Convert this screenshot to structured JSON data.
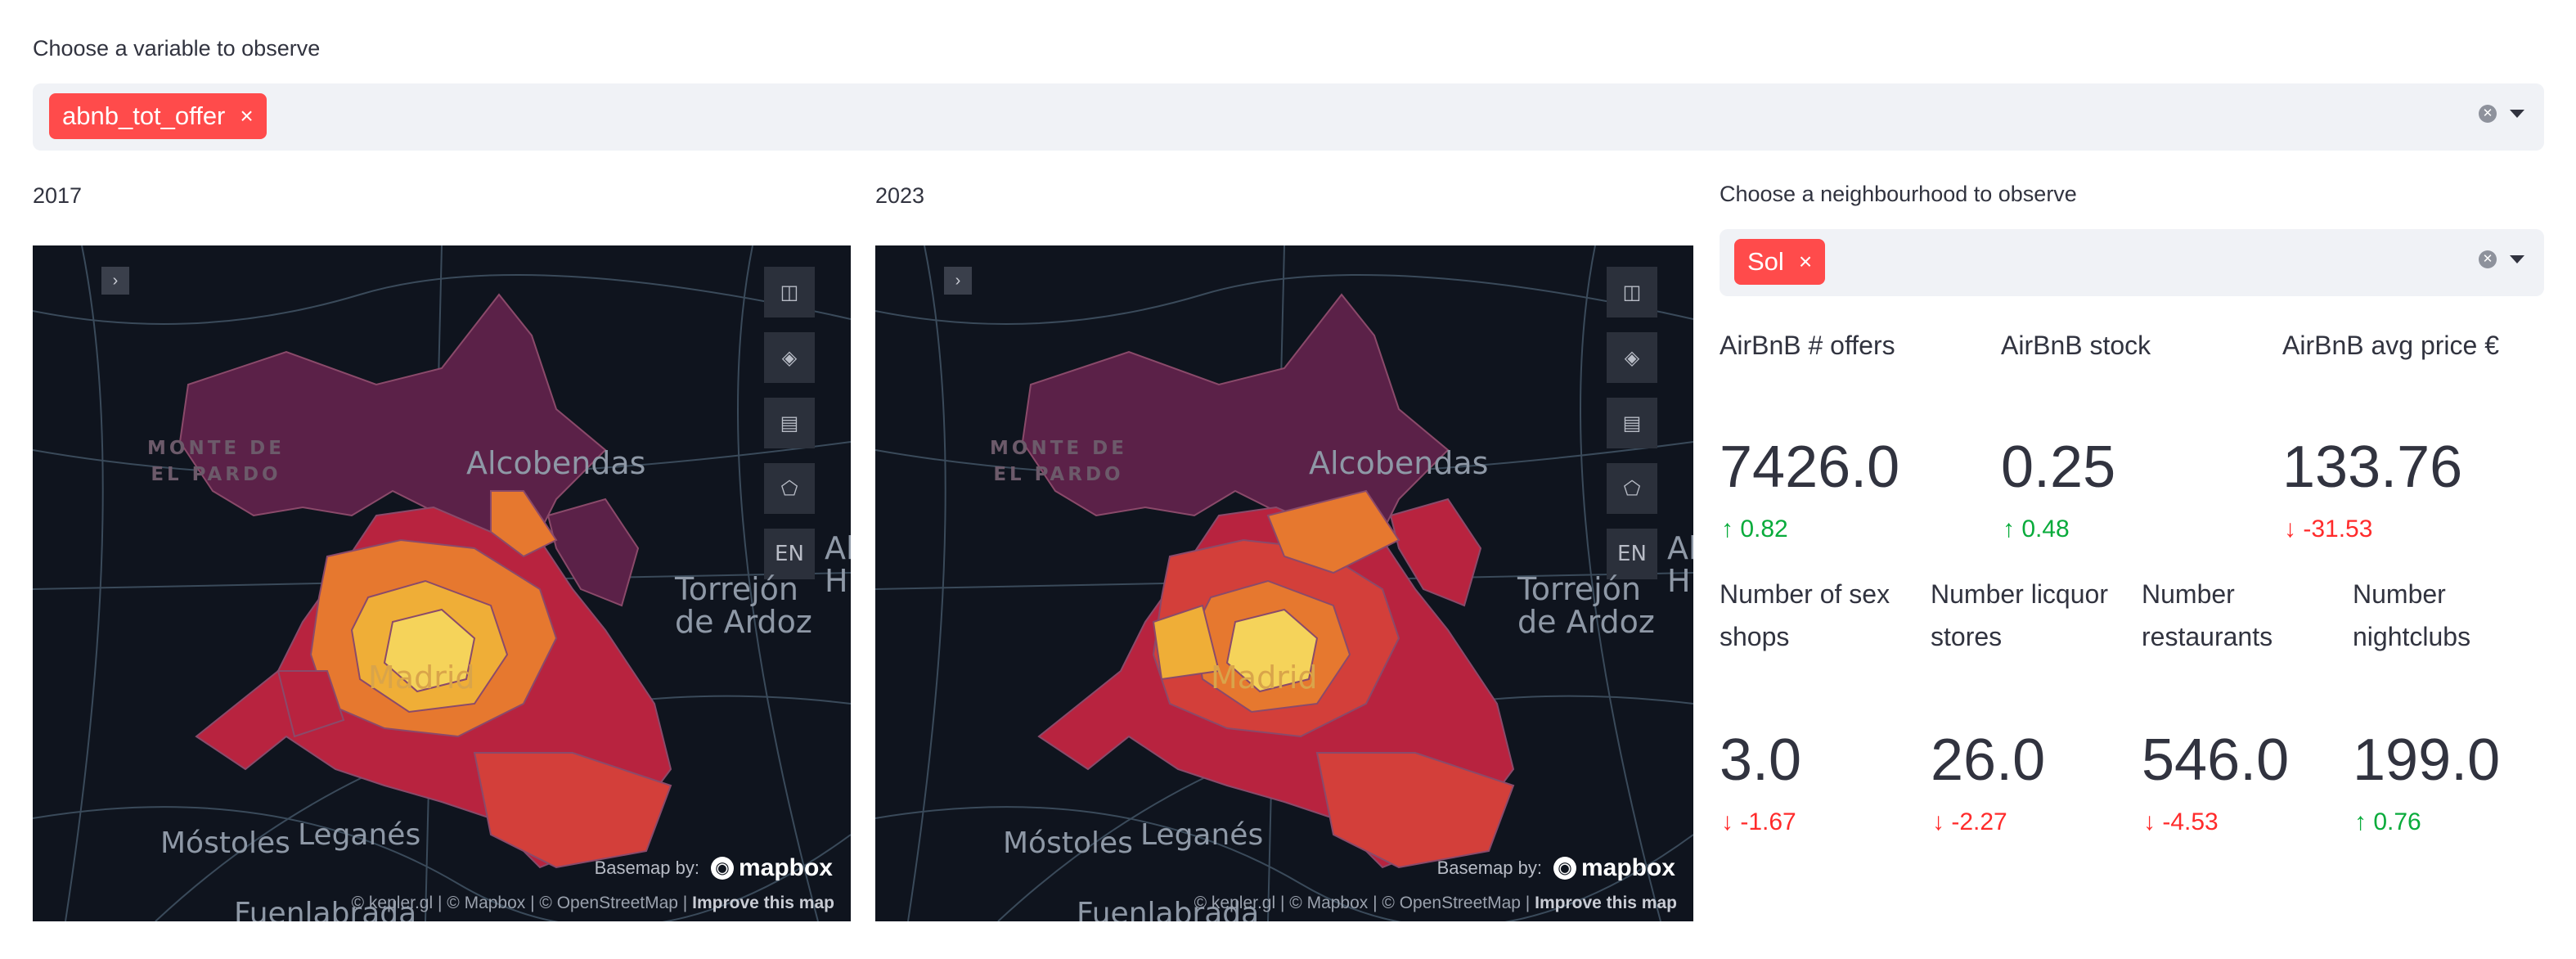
{
  "variable_select": {
    "label": "Choose a variable to observe",
    "selected_tag": "abnb_tot_offer",
    "remove_glyph": "×"
  },
  "maps": [
    {
      "year": "2017",
      "toggle_glyph": "›",
      "lang": "EN",
      "places": {
        "park": "MONTE DE\nEL PARDO",
        "alcobendas": "Alcobendas",
        "torrejon": "Torrejón\nde Ardoz",
        "madrid": "Madrid",
        "mostoles": "Móstoles",
        "leganes": "Leganés",
        "fuenlabrada": "Fuenlabrada",
        "edge": "Al\nH"
      },
      "basemap": "Basemap by:",
      "mapbox": "mapbox",
      "attribution": "© kepler.gl | © Mapbox | © OpenStreetMap |",
      "improve": "Improve this map"
    },
    {
      "year": "2023",
      "toggle_glyph": "›",
      "lang": "EN",
      "places": {
        "park": "MONTE DE\nEL PARDO",
        "alcobendas": "Alcobendas",
        "torrejon": "Torrejón\nde Ardoz",
        "madrid": "Madrid",
        "mostoles": "Móstoles",
        "leganes": "Leganés",
        "fuenlabrada": "Fuenlabrada",
        "edge": "Al\nH"
      },
      "basemap": "Basemap by:",
      "mapbox": "mapbox",
      "attribution": "© kepler.gl | © Mapbox | © OpenStreetMap |",
      "improve": "Improve this map"
    }
  ],
  "neighbourhood_select": {
    "label": "Choose a neighbourhood to observe",
    "selected_tag": "Sol",
    "remove_glyph": "×"
  },
  "metrics_row1": [
    {
      "label": "AirBnB # offers",
      "value": "7426.0",
      "delta": "0.82",
      "direction": "up"
    },
    {
      "label": "AirBnB stock",
      "value": "0.25",
      "delta": "0.48",
      "direction": "up"
    },
    {
      "label": "AirBnB avg price €",
      "value": "133.76",
      "delta": "-31.53",
      "direction": "down"
    }
  ],
  "metrics_row2": [
    {
      "label": "Number of sex shops",
      "value": "3.0",
      "delta": "-1.67",
      "direction": "down"
    },
    {
      "label": "Number licquor stores",
      "value": "26.0",
      "delta": "-2.27",
      "direction": "down"
    },
    {
      "label": "Number restaurants",
      "value": "546.0",
      "delta": "-4.53",
      "direction": "down"
    },
    {
      "label": "Number nightclubs",
      "value": "199.0",
      "delta": "0.76",
      "direction": "up"
    }
  ],
  "icons": {
    "clear": "clear-icon",
    "caret": "chevron-down-icon",
    "split": "split-map-icon",
    "layers": "layers-icon",
    "legend": "legend-icon",
    "draw": "draw-polygon-icon",
    "arrow_up": "arrow-up-icon",
    "arrow_down": "arrow-down-icon"
  },
  "colors": {
    "accent": "#ff4b4b",
    "map_bg": "#0f141e",
    "up": "#09ab3b",
    "down": "#ff2b2b",
    "choropleth": [
      "#5b2148",
      "#b8233f",
      "#d33f3a",
      "#e6782f",
      "#efae37",
      "#f5d35a"
    ]
  }
}
